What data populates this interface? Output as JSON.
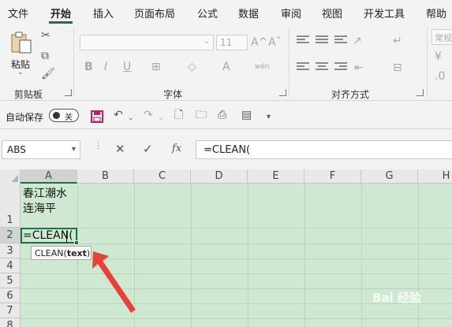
{
  "menu": {
    "tabs": [
      {
        "label": "文件"
      },
      {
        "label": "开始"
      },
      {
        "label": "插入"
      },
      {
        "label": "页面布局"
      },
      {
        "label": "公式"
      },
      {
        "label": "数据"
      },
      {
        "label": "审阅"
      },
      {
        "label": "视图"
      },
      {
        "label": "开发工具"
      },
      {
        "label": "帮助"
      }
    ],
    "active_tab": "开始"
  },
  "ribbon": {
    "clipboard": {
      "paste_label": "粘贴",
      "group_label": "剪贴板"
    },
    "font": {
      "font_size": "11",
      "group_label": "字体",
      "bold": "B",
      "italic": "I",
      "underline": "U",
      "font_color_glyph": "A",
      "phonetic": "wén"
    },
    "alignment": {
      "group_label": "对齐方式"
    },
    "number": {
      "format_label": "常规"
    }
  },
  "quick_access": {
    "autosave_label": "自动保存",
    "autosave_state": "关"
  },
  "formula_bar": {
    "name_box": "ABS",
    "cancel_glyph": "✕",
    "enter_glyph": "✓",
    "fx_label": "fx",
    "formula": "=CLEAN("
  },
  "sheet": {
    "columns": [
      "A",
      "B",
      "C",
      "D",
      "E",
      "F",
      "G",
      "H"
    ],
    "rows": [
      "1",
      "2",
      "3",
      "4",
      "5",
      "6",
      "7",
      "8"
    ],
    "cells": {
      "A1_line1": "春江潮水",
      "A1_line2": "连海平",
      "A2": "=CLEAN("
    },
    "tooltip": {
      "func": "CLEAN(",
      "arg": "text",
      "close": ")"
    }
  },
  "watermark": "Bai 经验",
  "colors": {
    "accent": "#1e7145",
    "grid_background": "#cfe8d2",
    "arrow": "#e8413a",
    "save_icon": "#b8246a"
  }
}
